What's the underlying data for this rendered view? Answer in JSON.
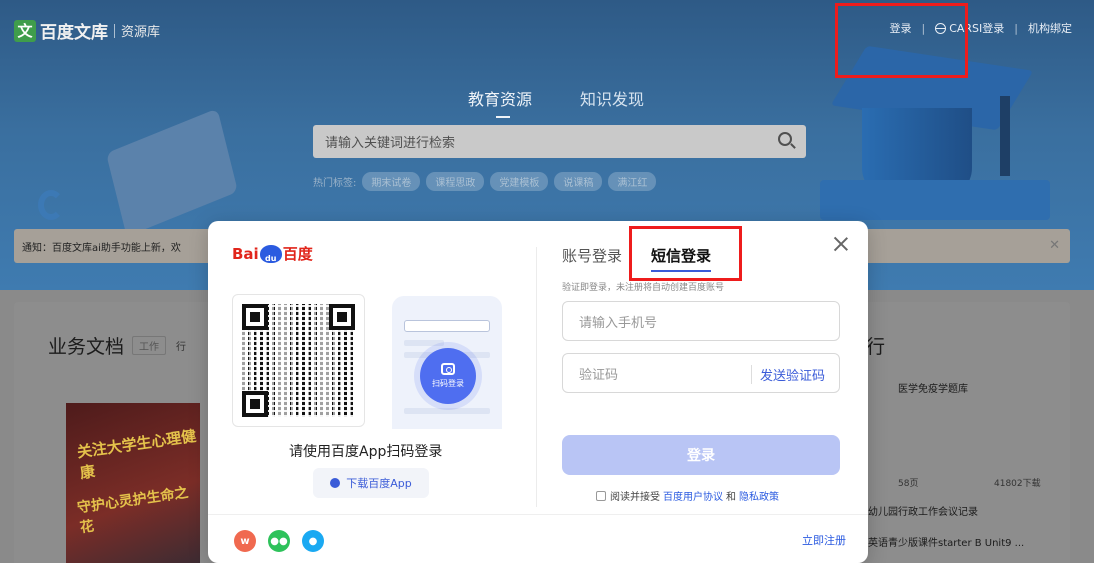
{
  "header": {
    "logo_mark": "文",
    "logo_text": "百度文库",
    "logo_sub": "资源库",
    "nav": {
      "login": "登录",
      "carsi": "CARSI登录",
      "org_bind": "机构绑定"
    }
  },
  "hero": {
    "tabs": [
      "教育资源",
      "知识发现"
    ],
    "search_placeholder": "请输入关键词进行检索",
    "hot_label": "热门标签:",
    "hot_tags": [
      "期末试卷",
      "课程思政",
      "党建模板",
      "说课稿",
      "满江红"
    ]
  },
  "notice": {
    "text": "通知：百度文库ai助手功能上新，欢"
  },
  "left_section": {
    "title": "业务文档",
    "chip1": "工作",
    "chip2": "行",
    "banner_line1": "关注大学生心理健康",
    "banner_line2": "守护心灵护生命之花"
  },
  "right_section": {
    "title": "行",
    "item1": "医学免疫学题库",
    "pages": "58页",
    "downloads": "41802下载",
    "item2": "幼儿园行政工作会议记录",
    "item3": "英语青少版课件starter B Unit9 ..."
  },
  "modal": {
    "brand": {
      "bai": "Bai",
      "paw": "du",
      "du": "百度"
    },
    "scan_hint": "请使用百度App扫码登录",
    "scan_button": "扫码登录",
    "download_app": "下载百度App",
    "tabs": {
      "account": "账号登录",
      "sms": "短信登录"
    },
    "sub_hint": "验证即登录，未注册将自动创建百度账号",
    "phone_placeholder": "请输入手机号",
    "code_placeholder": "验证码",
    "send_code": "发送验证码",
    "login_button": "登录",
    "agree_prefix": "阅读并接受",
    "agree_link1": "百度用户协议",
    "agree_and": "和",
    "agree_link2": "隐私政策",
    "register": "立即注册",
    "social_icons": [
      "weibo-icon",
      "wechat-icon",
      "qq-icon"
    ]
  },
  "colors": {
    "accent": "#3a5bd8",
    "baidu_red": "#e1251b",
    "annotation": "#ee1c1c",
    "login_btn": "#b9c5f5"
  }
}
